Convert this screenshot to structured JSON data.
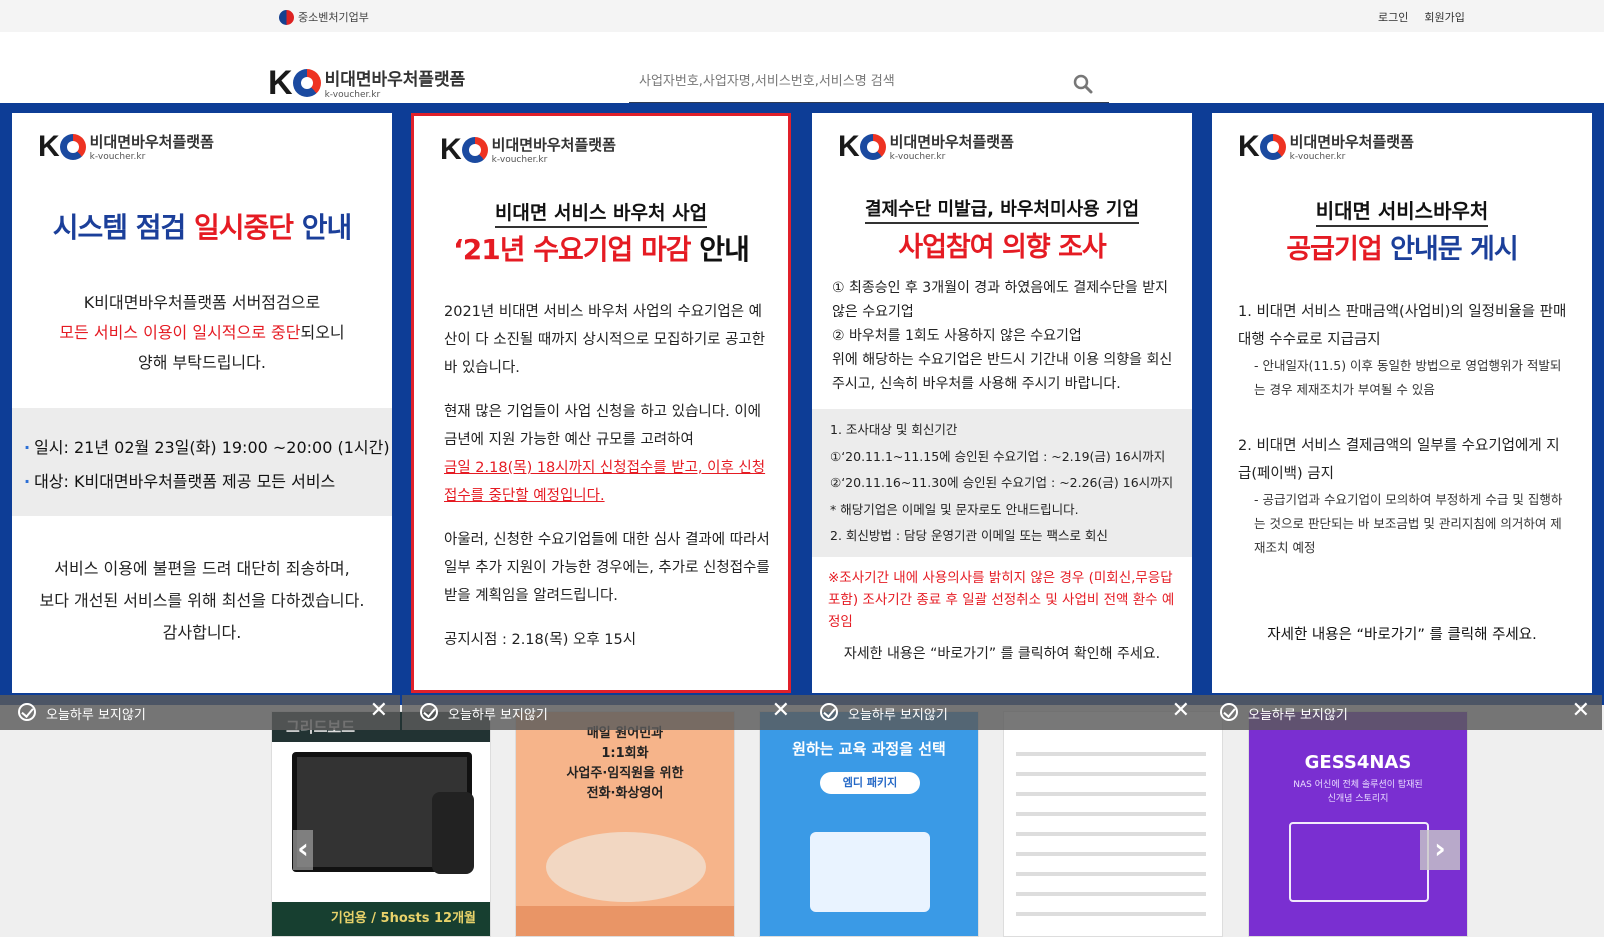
{
  "topbar": {
    "ministry": "중소벤처기업부",
    "login": "로그인",
    "signup": "회원가입"
  },
  "logo": {
    "name": "비대면바우처플랫폼",
    "url": "k-voucher.kr"
  },
  "search": {
    "placeholder": "사업자번호,사업자명,서비스번호,서비스명 검색"
  },
  "panel1": {
    "title_a": "시스템 점검 ",
    "title_b": "일시중단",
    "title_c": " 안내",
    "intro_1": "K비대면바우처플랫폼 서버점검으로",
    "intro_2a": "모든 서비스 이용이 일시적으로 중단",
    "intro_2b": "되오니",
    "intro_3": "양해 부탁드립니다.",
    "date": "일시: 21년 02월 23일(화) 19:00 ~20:00 (1시간)",
    "target": "대상:  K비대면바우처플랫폼 제공 모든 서비스",
    "outro_1": "서비스 이용에 불편을 드려 대단히 죄송하며,",
    "outro_2": "보다 개선된 서비스를 위해 최선을 다하겠습니다.",
    "outro_3": "감사합니다."
  },
  "panel2": {
    "sub": "비대면 서비스 바우처 사업",
    "title_a": "‘21년 수요기업 마감",
    "title_b": " 안내",
    "p1": "2021년 비대면 서비스 바우처 사업의 수요기업은 예산이 다 소진될 때까지 상시적으로 모집하기로 공고한 바 있습니다.",
    "p2a": "현재 많은 기업들이 사업 신청을 하고 있습니다. 이에 금년에 지원 가능한 예산 규모를 고려하여",
    "p2b": "금일 2.18(목) 18시까지 신청접수를 받고, 이후 신청접수를 중단할 예정입니다.",
    "p3": "아울러, 신청한 수요기업들에 대한 심사 결과에 따라서 일부 추가 지원이 가능한 경우에는, 추가로 신청접수를 받을 계획임을 알려드립니다.",
    "p4": "공지시점 : 2.18(목) 오후 15시"
  },
  "panel3": {
    "sub": "결제수단 미발급, 바우처미사용 기업",
    "title": "사업참여 의향 조사",
    "b1": "① 최종승인 후 3개월이 경과 하였음에도 결제수단을 받지 않은 수요기업",
    "b2": "② 바우처를 1회도 사용하지 않은 수요기업",
    "b3": "위에 해당하는 수요기업은 반드시 기간내 이용 의향을 회신 주시고, 신속히 바우처를 사용해 주시기 바랍니다.",
    "g1": "1. 조사대상 및 회신기간",
    "g2": "①‘20.11.1~11.15에 승인된 수요기업 : ~2.19(금) 16시까지",
    "g3": "②‘20.11.16~11.30에 승인된 수요기업 : ~2.26(금) 16시까지",
    "g4": "  * 해당기업은 이메일 및 문자로도 안내드립니다.",
    "g5": "2. 회신방법 : 담당 운영기관 이메일 또는 팩스로 회신",
    "warn": "※조사기간 내에 사용의사를 밝히지 않은 경우 (미회신,무응답 포함) 조사기간 종료 후 일괄 선정취소 및 사업비 전액 환수 예정임",
    "foot": "자세한 내용은 “바로가기” 를 클릭하여 확인해 주세요."
  },
  "panel4": {
    "sub": "비대면 서비스바우처",
    "title_a": "공급기업",
    "title_b": " 안내문 게시",
    "i1": "1.  비대면 서비스 판매금액(사업비)의 일정비율을 판매대행 수수료로 지급금지",
    "i1s": "- 안내일자(11.5) 이후 동일한 방법으로 영업행위가 적발되는 경우 제재조치가 부여될 수 있음",
    "i2": "2. 비대면 서비스 결제금액의 일부를 수요기업에게 지급(페이백) 금지",
    "i2s": "- 공급기업과 수요기업이 모의하여 부정하게 수급 및 집행하는 것으로 판단되는 바 보조금법 및 관리지침에 의거하여 제재조치 예정",
    "foot": "자세한 내용은 “바로가기” 를 클릭해 주세요."
  },
  "dismiss_label": "오늘하루 보지않기",
  "cards": {
    "c1_title": "그리드보드",
    "c1_band": "기업용 / 5hosts 12개월",
    "c2_text": "매일 원어민과\n1:1회화\n사업주·임직원을 위한\n전화·화상영어",
    "c3_text": "원하는 교육 과정을 선택",
    "c3_pill": "엠디 패키지",
    "c5_title": "GESS4NAS",
    "c5_sub": "NAS 어신에 전체 솔루션이 탑재된\n신개념 스토리지"
  },
  "colors": {
    "brand_blue": "#0d3d96",
    "accent_red": "#e51b23",
    "title_blue": "#1b3f9a"
  }
}
